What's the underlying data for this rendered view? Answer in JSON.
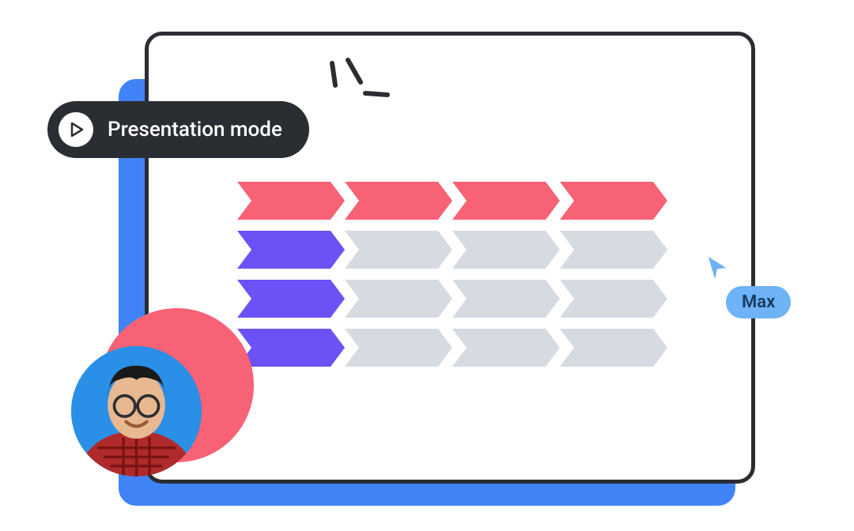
{
  "button": {
    "label": "Presentation mode"
  },
  "cursor": {
    "user_name": "Max"
  },
  "colors": {
    "accent_blue": "#4083f7",
    "light_blue": "#6db3f5",
    "dark": "#2a2e33",
    "pink": "#f76276",
    "purple": "#6b52f5",
    "grey": "#d6dbe2"
  },
  "chevron_rows": [
    {
      "count": 4,
      "colors": [
        "pink",
        "pink",
        "pink",
        "pink"
      ]
    },
    {
      "count": 4,
      "colors": [
        "purple",
        "grey",
        "grey",
        "grey"
      ]
    },
    {
      "count": 4,
      "colors": [
        "purple",
        "grey",
        "grey",
        "grey"
      ]
    },
    {
      "count": 4,
      "colors": [
        "purple",
        "grey",
        "grey",
        "grey"
      ]
    }
  ]
}
